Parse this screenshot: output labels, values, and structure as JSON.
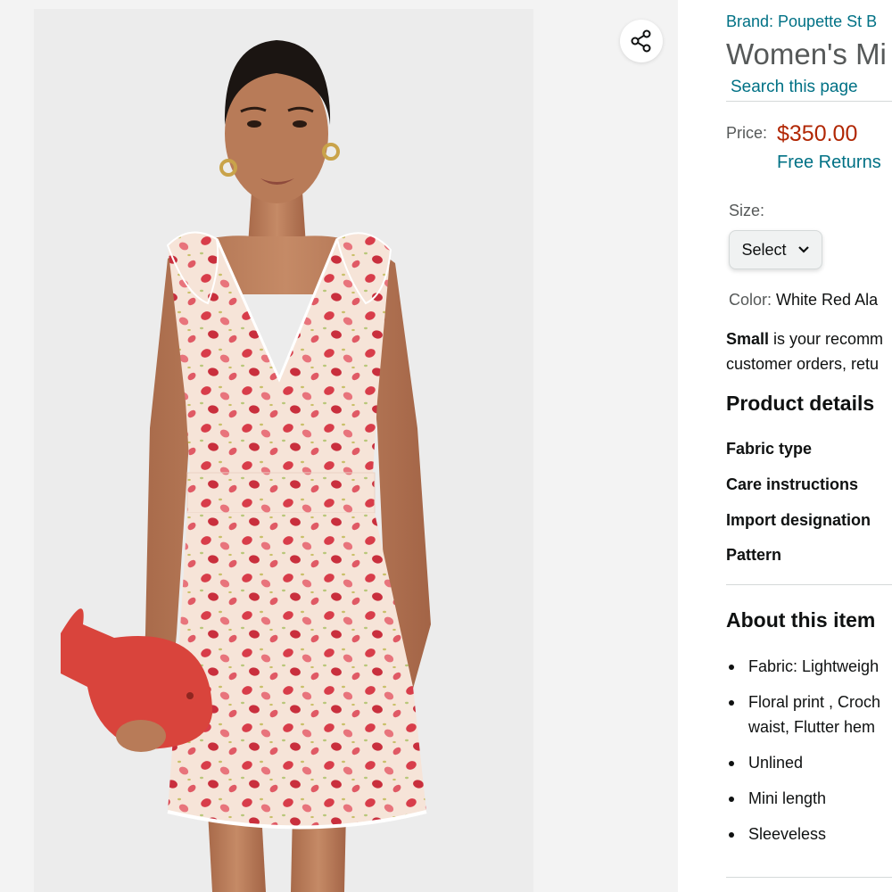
{
  "product": {
    "brand_link": "Brand: Poupette St B",
    "title": "Women's Mi",
    "search_link": "Search this page"
  },
  "price": {
    "label": "Price:",
    "value": "$350.00",
    "returns": "Free Returns"
  },
  "size": {
    "label": "Size:",
    "selected": "Select",
    "chevron": "chevron-down-icon"
  },
  "color": {
    "label": "Color:",
    "value": "White Red Ala"
  },
  "recommendation": {
    "bold": "Small",
    "line1": " is your recomm",
    "line2": "customer orders, retu"
  },
  "product_details": {
    "heading": "Product details",
    "rows": [
      "Fabric type",
      "Care instructions",
      "Import designation",
      "Pattern"
    ]
  },
  "about": {
    "heading": "About this item",
    "bullets": [
      "Fabric: Lightweigh",
      "Floral print , Croch",
      "waist, Flutter hem",
      "Unlined",
      "Mini length",
      "Sleeveless"
    ]
  },
  "gallery": {
    "share_icon": "share-icon",
    "image": "model-in-floral-dress-photo"
  },
  "colors": {
    "link": "#007185",
    "price": "#b12704",
    "muted": "#565959",
    "text": "#0f1111"
  }
}
